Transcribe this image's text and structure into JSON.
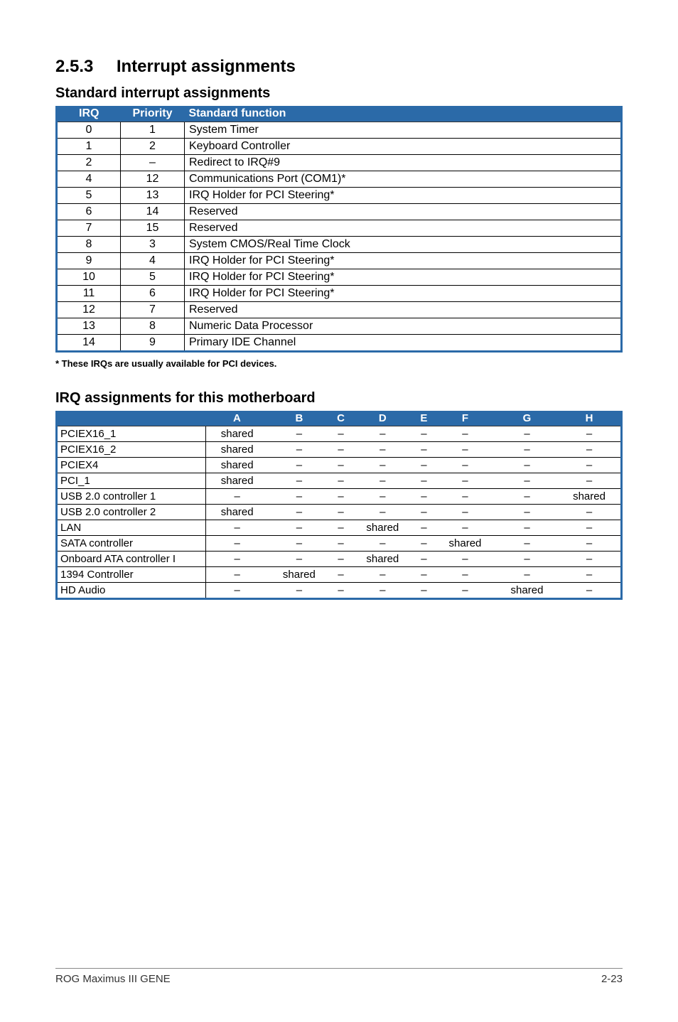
{
  "section": {
    "num": "2.5.3",
    "title": "Interrupt assignments"
  },
  "sub1": "Standard interrupt assignments",
  "table1": {
    "headers": {
      "irq": "IRQ",
      "priority": "Priority",
      "func": "Standard function"
    },
    "rows": [
      {
        "irq": "0",
        "priority": "1",
        "func": "System Timer"
      },
      {
        "irq": "1",
        "priority": "2",
        "func": "Keyboard Controller"
      },
      {
        "irq": "2",
        "priority": "–",
        "func": "Redirect to IRQ#9"
      },
      {
        "irq": "4",
        "priority": "12",
        "func": "Communications Port (COM1)*"
      },
      {
        "irq": "5",
        "priority": "13",
        "func": "IRQ Holder for PCI Steering*"
      },
      {
        "irq": "6",
        "priority": "14",
        "func": "Reserved"
      },
      {
        "irq": "7",
        "priority": "15",
        "func": "Reserved"
      },
      {
        "irq": "8",
        "priority": "3",
        "func": "System CMOS/Real Time Clock"
      },
      {
        "irq": "9",
        "priority": "4",
        "func": "IRQ Holder for PCI Steering*"
      },
      {
        "irq": "10",
        "priority": "5",
        "func": "IRQ Holder for PCI Steering*"
      },
      {
        "irq": "11",
        "priority": "6",
        "func": "IRQ Holder for PCI Steering*"
      },
      {
        "irq": "12",
        "priority": "7",
        "func": "Reserved"
      },
      {
        "irq": "13",
        "priority": "8",
        "func": "Numeric Data Processor"
      },
      {
        "irq": "14",
        "priority": "9",
        "func": "Primary IDE Channel"
      }
    ]
  },
  "footnote": "* These IRQs are usually available for PCI devices.",
  "sub2": "IRQ assignments for this motherboard",
  "table2": {
    "headers": {
      "blank": "",
      "A": "A",
      "B": "B",
      "C": "C",
      "D": "D",
      "E": "E",
      "F": "F",
      "G": "G",
      "H": "H"
    },
    "rows": [
      {
        "label": "PCIEX16_1",
        "A": "shared",
        "B": "–",
        "C": "–",
        "D": "–",
        "E": "–",
        "F": "–",
        "G": "–",
        "H": "–"
      },
      {
        "label": "PCIEX16_2",
        "A": "shared",
        "B": "–",
        "C": "–",
        "D": "–",
        "E": "–",
        "F": "–",
        "G": "–",
        "H": "–"
      },
      {
        "label": "PCIEX4",
        "A": "shared",
        "B": "–",
        "C": "–",
        "D": "–",
        "E": "–",
        "F": "–",
        "G": "–",
        "H": "–"
      },
      {
        "label": "PCI_1",
        "A": "shared",
        "B": "–",
        "C": "–",
        "D": "–",
        "E": "–",
        "F": "–",
        "G": "–",
        "H": "–"
      },
      {
        "label": "USB 2.0 controller 1",
        "A": "–",
        "B": "–",
        "C": "–",
        "D": "–",
        "E": "–",
        "F": "–",
        "G": "–",
        "H": "shared"
      },
      {
        "label": "USB 2.0 controller 2",
        "A": "shared",
        "B": "–",
        "C": "–",
        "D": "–",
        "E": "–",
        "F": "–",
        "G": "–",
        "H": "–"
      },
      {
        "label": "LAN",
        "A": "–",
        "B": "–",
        "C": "–",
        "D": "shared",
        "E": "–",
        "F": "–",
        "G": "–",
        "H": "–"
      },
      {
        "label": "SATA controller",
        "A": "–",
        "B": "–",
        "C": "–",
        "D": "–",
        "E": "–",
        "F": "shared",
        "G": "–",
        "H": "–"
      },
      {
        "label": "Onboard ATA controller I",
        "A": "–",
        "B": "–",
        "C": "–",
        "D": "shared",
        "E": "–",
        "F": "–",
        "G": "–",
        "H": "–"
      },
      {
        "label": "1394 Controller",
        "A": "–",
        "B": "shared",
        "C": "–",
        "D": "–",
        "E": "–",
        "F": "–",
        "G": "–",
        "H": "–"
      },
      {
        "label": "HD Audio",
        "A": "–",
        "B": "–",
        "C": "–",
        "D": "–",
        "E": "–",
        "F": "–",
        "G": "shared",
        "H": "–"
      }
    ]
  },
  "footer": {
    "left": "ROG Maximus III GENE",
    "right": "2-23"
  }
}
